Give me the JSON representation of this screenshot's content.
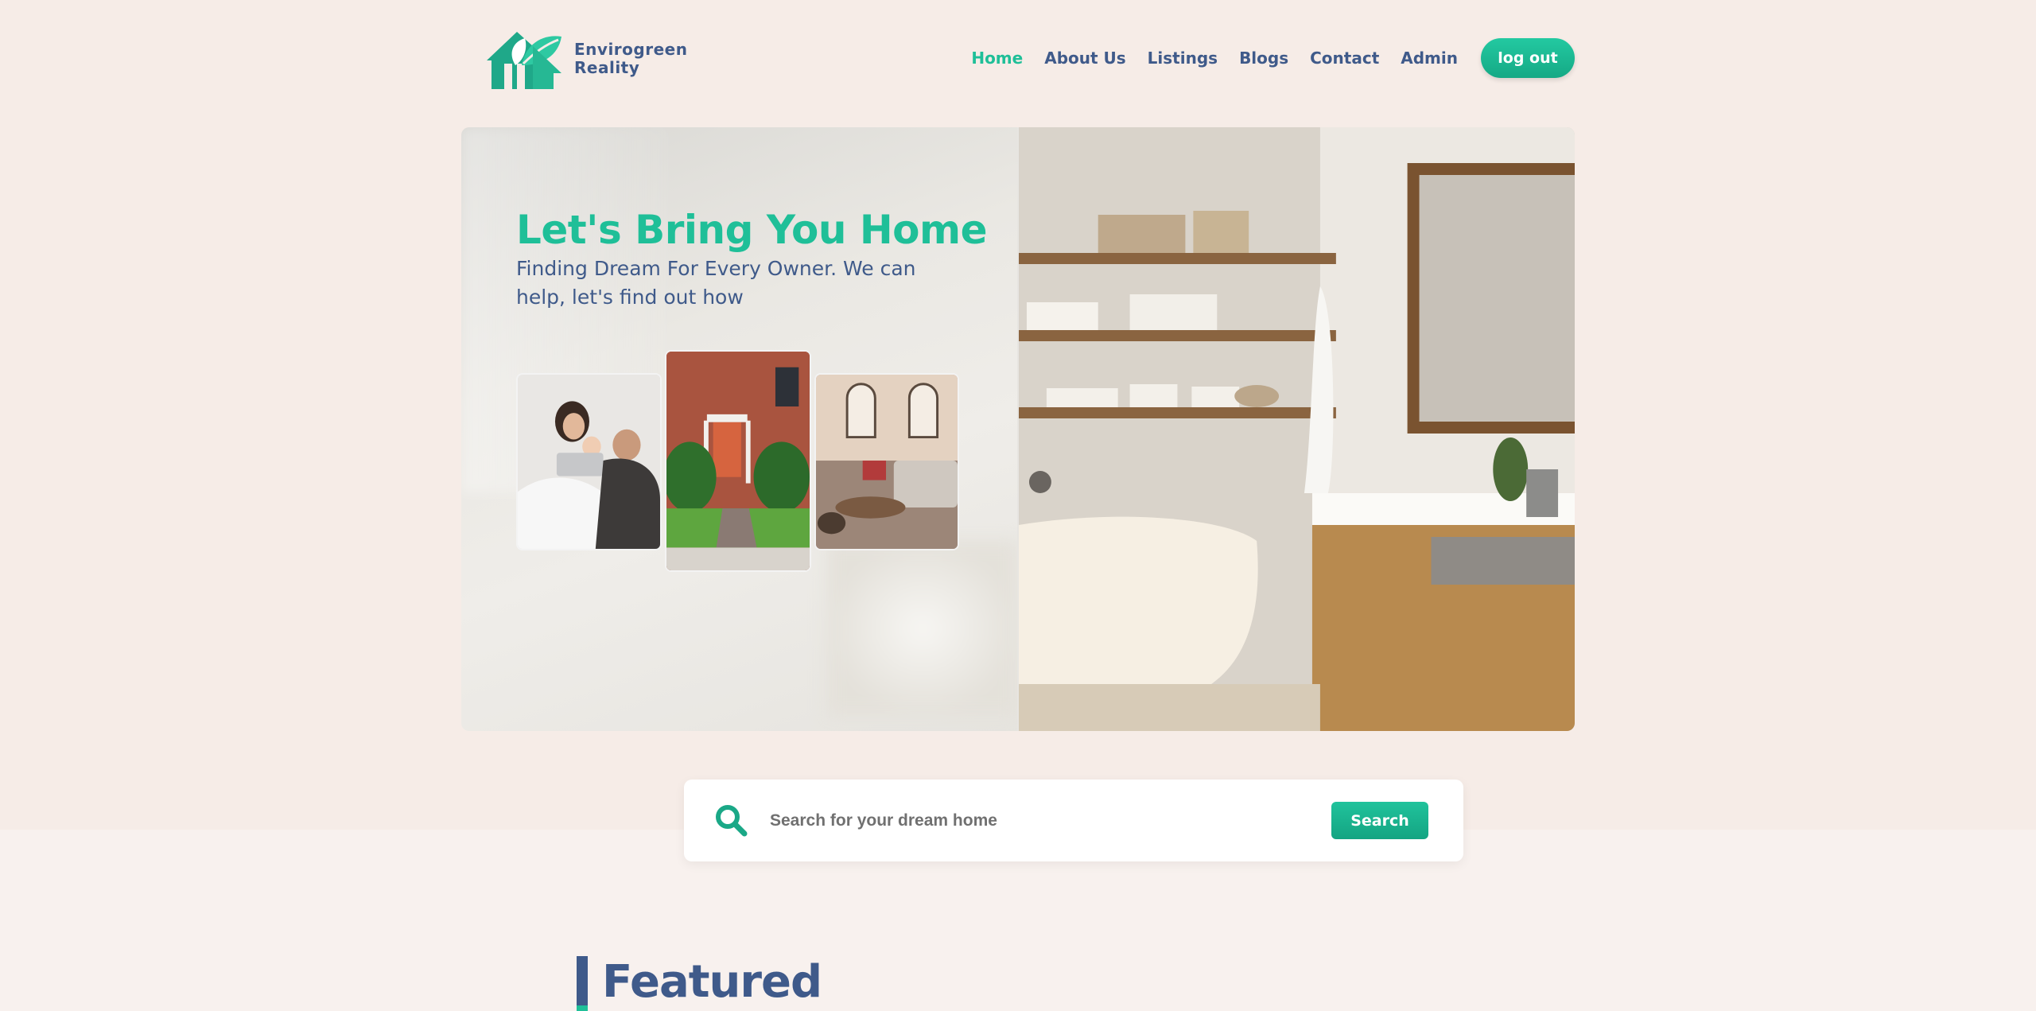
{
  "brand": {
    "name_line1": "Envirogreen",
    "name_line2": "Reality",
    "logo_icon": "house-leaf-icon",
    "accent_color": "#1fbf98",
    "primary_color": "#3f5a8a"
  },
  "nav": {
    "items": [
      {
        "label": "Home",
        "active": true
      },
      {
        "label": "About Us"
      },
      {
        "label": "Listings"
      },
      {
        "label": "Blogs"
      },
      {
        "label": "Contact"
      },
      {
        "label": "Admin"
      }
    ],
    "logout_label": "log out"
  },
  "hero": {
    "title": "Let's Bring You Home",
    "subtitle": "Finding Dream For Every Owner. We can help, let's find out how",
    "photos": [
      "family-photo",
      "brick-house-photo",
      "living-room-photo"
    ],
    "side_image": "bathroom-photo"
  },
  "search": {
    "icon": "search-icon",
    "placeholder": "Search for your dream home",
    "button_label": "Search"
  },
  "featured": {
    "title": "Featured"
  }
}
